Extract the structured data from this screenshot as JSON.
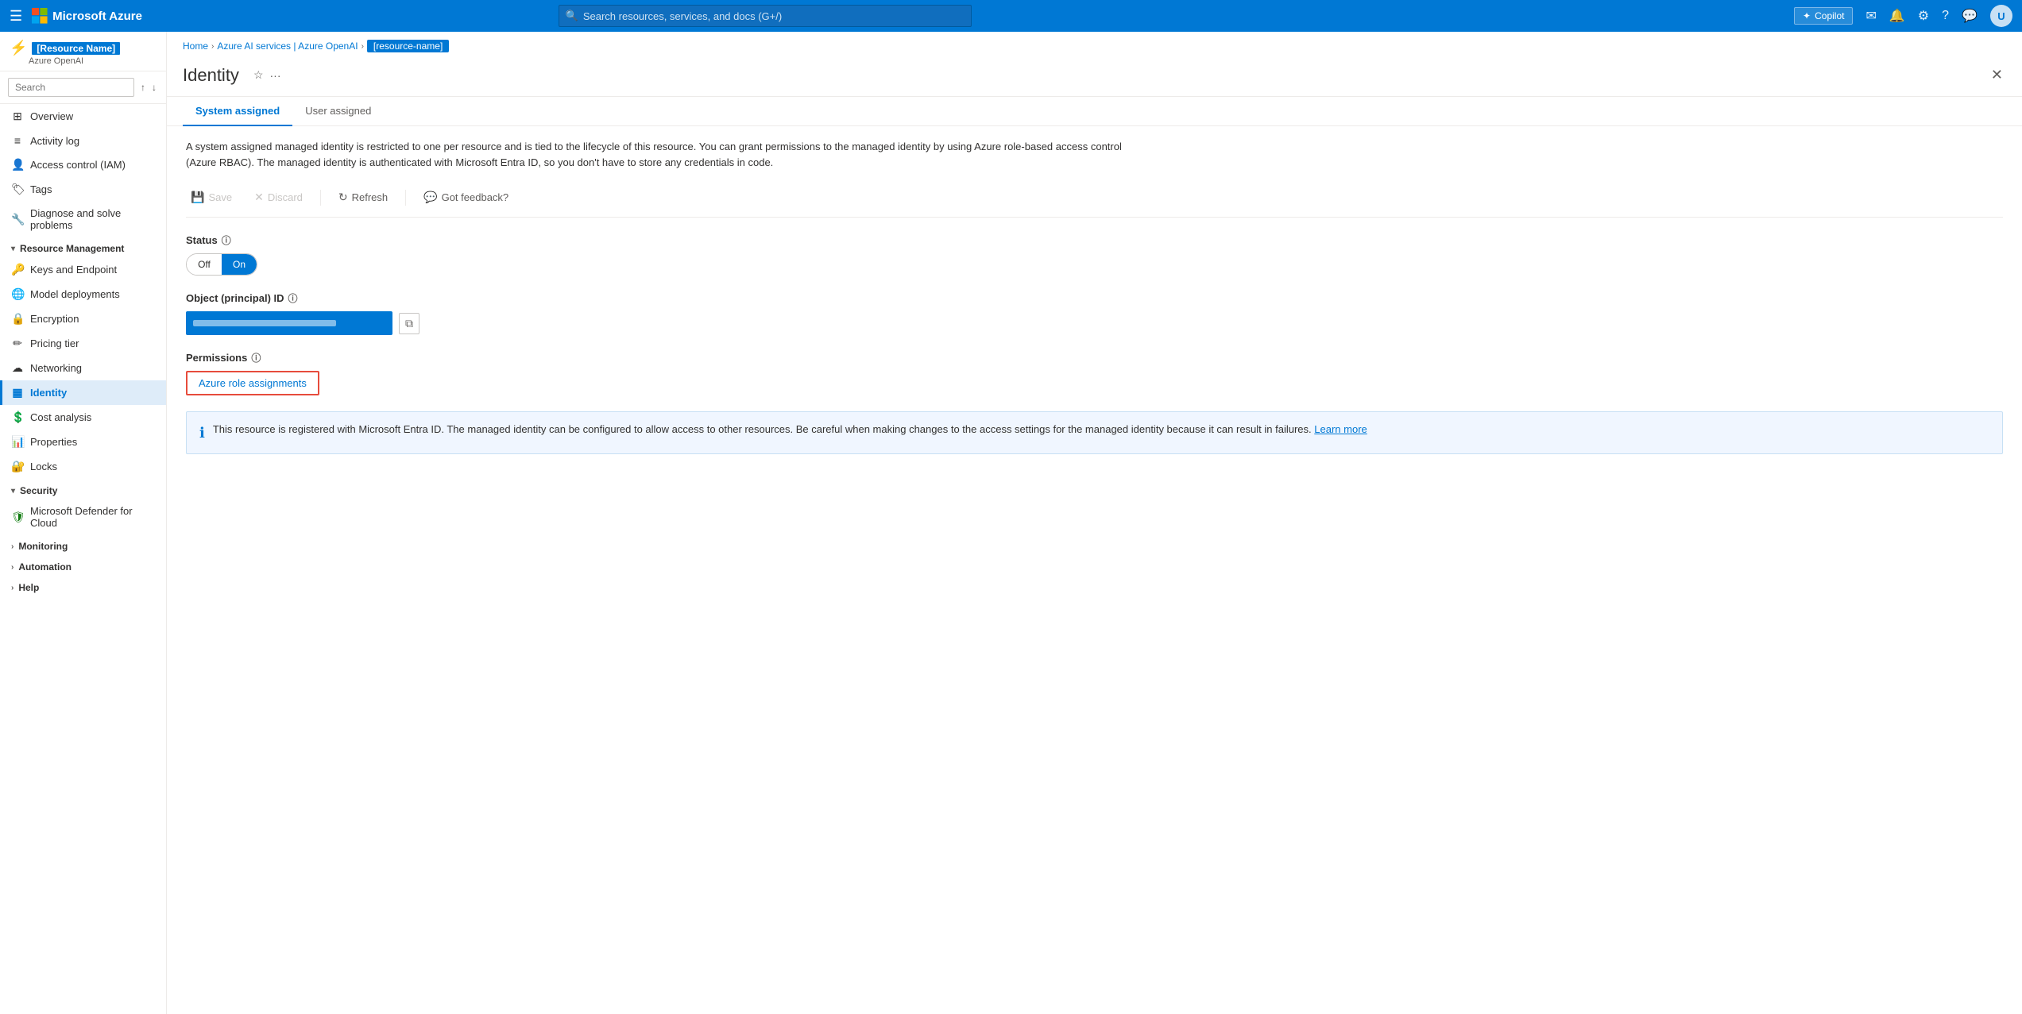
{
  "topnav": {
    "brand": "Microsoft Azure",
    "search_placeholder": "Search resources, services, and docs (G+/)",
    "copilot_label": "Copilot"
  },
  "breadcrumb": {
    "home": "Home",
    "services": "Azure AI services | Azure OpenAI",
    "current": "[resource-name]"
  },
  "resource": {
    "icon": "⚡",
    "name": "[Resource Name]",
    "subtitle": "Azure OpenAI"
  },
  "sidebar": {
    "search_placeholder": "Search",
    "items": [
      {
        "label": "Overview",
        "icon": "⊞",
        "active": false
      },
      {
        "label": "Activity log",
        "icon": "≡",
        "active": false
      },
      {
        "label": "Access control (IAM)",
        "icon": "👤",
        "active": false
      },
      {
        "label": "Tags",
        "icon": "🏷",
        "active": false
      },
      {
        "label": "Diagnose and solve problems",
        "icon": "🔧",
        "active": false
      }
    ],
    "resource_management": {
      "label": "Resource Management",
      "items": [
        {
          "label": "Keys and Endpoint",
          "icon": "🔑",
          "active": false
        },
        {
          "label": "Model deployments",
          "icon": "🌐",
          "active": false
        },
        {
          "label": "Encryption",
          "icon": "🔒",
          "active": false
        },
        {
          "label": "Pricing tier",
          "icon": "✏",
          "active": false
        },
        {
          "label": "Networking",
          "icon": "☁",
          "active": false
        },
        {
          "label": "Identity",
          "icon": "▦",
          "active": true
        }
      ]
    },
    "other_items": [
      {
        "label": "Cost analysis",
        "icon": "💲",
        "active": false
      },
      {
        "label": "Properties",
        "icon": "📊",
        "active": false
      },
      {
        "label": "Locks",
        "icon": "🔐",
        "active": false
      }
    ],
    "security": {
      "label": "Security",
      "items": [
        {
          "label": "Microsoft Defender for Cloud",
          "icon": "🛡",
          "active": false
        }
      ]
    },
    "collapsible": [
      {
        "label": "Monitoring",
        "expanded": false
      },
      {
        "label": "Automation",
        "expanded": false
      },
      {
        "label": "Help",
        "expanded": false
      }
    ]
  },
  "page": {
    "title": "Identity",
    "tabs": [
      {
        "label": "System assigned",
        "active": true
      },
      {
        "label": "User assigned",
        "active": false
      }
    ],
    "description": "A system assigned managed identity is restricted to one per resource and is tied to the lifecycle of this resource. You can grant permissions to the managed identity by using Azure role-based access control (Azure RBAC). The managed identity is authenticated with Microsoft Entra ID, so you don't have to store any credentials in code.",
    "toolbar": {
      "save": "Save",
      "discard": "Discard",
      "refresh": "Refresh",
      "feedback": "Got feedback?"
    },
    "status_label": "Status",
    "toggle_off": "Off",
    "toggle_on": "On",
    "object_id_label": "Object (principal) ID",
    "permissions_label": "Permissions",
    "azure_role_btn": "Azure role assignments",
    "info_banner_text": "This resource is registered with Microsoft Entra ID. The managed identity can be configured to allow access to other resources. Be careful when making changes to the access settings for the managed identity because it can result in failures.",
    "learn_more": "Learn more"
  }
}
